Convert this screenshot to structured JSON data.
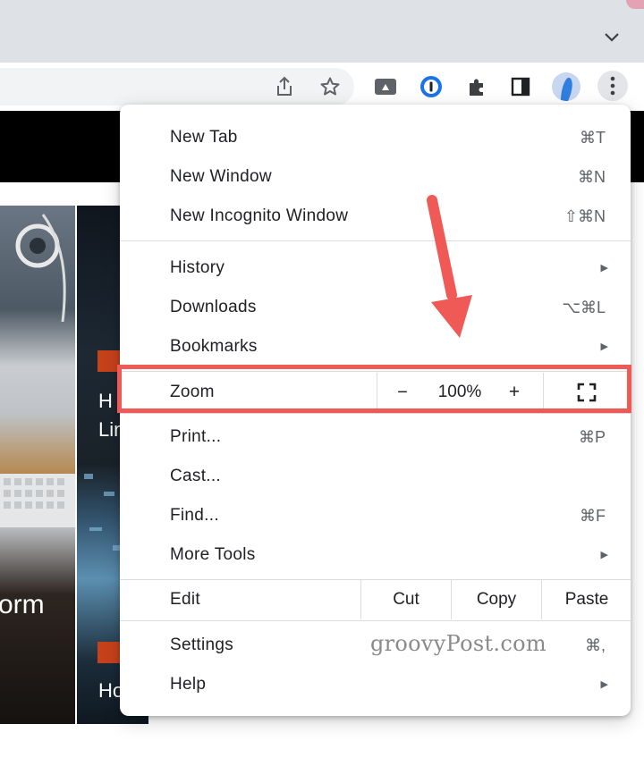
{
  "menu": {
    "items_top": [
      {
        "label": "New Tab",
        "shortcut": "⌘T"
      },
      {
        "label": "New Window",
        "shortcut": "⌘N"
      },
      {
        "label": "New Incognito Window",
        "shortcut": "⇧⌘N"
      }
    ],
    "items_mid": [
      {
        "label": "History",
        "has_submenu": true
      },
      {
        "label": "Downloads",
        "shortcut": "⌥⌘L"
      },
      {
        "label": "Bookmarks",
        "has_submenu": true
      }
    ],
    "zoom": {
      "label": "Zoom",
      "minus": "−",
      "value": "100%",
      "plus": "+"
    },
    "items_tools": [
      {
        "label": "Print...",
        "shortcut": "⌘P"
      },
      {
        "label": "Cast..."
      },
      {
        "label": "Find...",
        "shortcut": "⌘F"
      },
      {
        "label": "More Tools",
        "has_submenu": true
      }
    ],
    "edit": {
      "label": "Edit",
      "cut": "Cut",
      "copy": "Copy",
      "paste": "Paste"
    },
    "items_bottom": [
      {
        "label": "Settings",
        "shortcut": "⌘,"
      },
      {
        "label": "Help",
        "has_submenu": true
      }
    ]
  },
  "page": {
    "big_text": "orm",
    "mid_text_1": "H",
    "mid_text_2": "Lin",
    "mid_text_3": "Ho"
  },
  "watermark": "groovyPost.com",
  "colors": {
    "highlight": "#ef5a56",
    "badge": "#c7411b"
  },
  "icons": [
    "chevron-down-icon",
    "share-icon",
    "star-icon",
    "drive-icon",
    "password-icon",
    "puzzle-icon",
    "side-panel-icon",
    "avatar",
    "three-dots-icon",
    "fullscreen-icon",
    "arrow-annotation"
  ]
}
